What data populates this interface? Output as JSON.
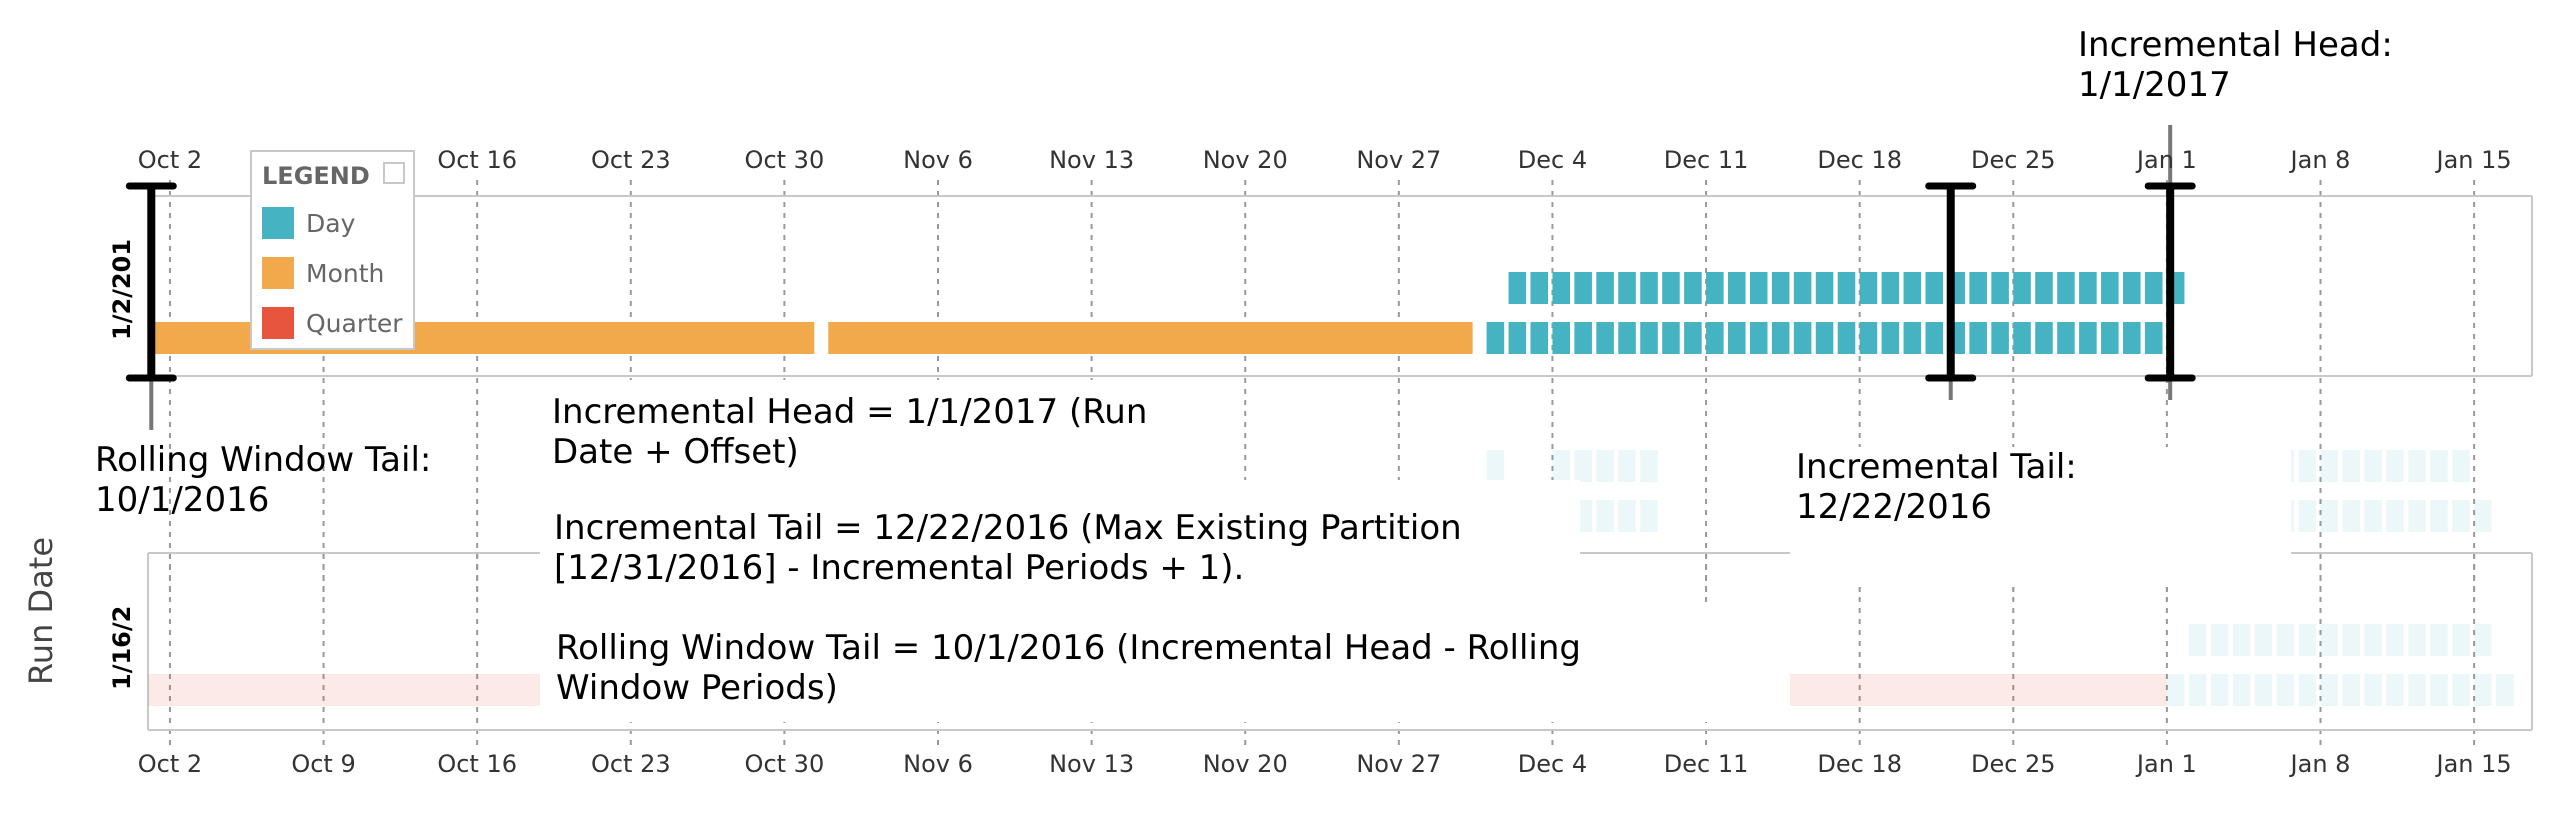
{
  "chart_data": {
    "type": "gantt",
    "y_axis_title": "Run Date",
    "x_tick_labels": [
      "Oct 2",
      "Oct 9",
      "Oct 16",
      "Oct 23",
      "Oct 30",
      "Nov 6",
      "Nov 13",
      "Nov 20",
      "Nov 27",
      "Dec 4",
      "Dec 11",
      "Dec 18",
      "Dec 25",
      "Jan 1",
      "Jan 8",
      "Jan 15"
    ],
    "x_range": [
      "2016-10-01",
      "2017-01-17"
    ],
    "rows": [
      {
        "label": "1/2/201",
        "partitions": {
          "month": [
            {
              "start": "2016-10-01",
              "end": "2016-10-31"
            },
            {
              "start": "2016-11-01",
              "end": "2016-11-30"
            }
          ],
          "day_lower": {
            "start": "2016-12-01",
            "end": "2016-12-31"
          },
          "day_upper": {
            "start": "2016-12-02",
            "end": "2017-01-01"
          }
        },
        "markers": [
          "2016-10-01",
          "2016-12-22",
          "2017-01-01"
        ]
      },
      {
        "label": "1/16/2",
        "partitions": {
          "quarter": [
            {
              "start": "2016-10-01",
              "end": "2016-12-31"
            }
          ],
          "day_lower": {
            "start": "2017-01-01",
            "end": "2017-01-16"
          },
          "day_upper": {
            "start": "2017-01-02",
            "end": "2017-01-15"
          }
        }
      }
    ],
    "ghost_partitions": {
      "upper": [
        "2016-12-01",
        "2016-12-04",
        "2016-12-05",
        "2016-12-06",
        "2016-12-07",
        "2016-12-08",
        "2017-01-04",
        "2017-01-05",
        "2017-01-06",
        "2017-01-07",
        "2017-01-08",
        "2017-01-09",
        "2017-01-10",
        "2017-01-11",
        "2017-01-12",
        "2017-01-13",
        "2017-01-14"
      ],
      "lower": [
        "2016-12-04",
        "2016-12-05",
        "2016-12-06",
        "2016-12-07",
        "2016-12-08",
        "2017-01-05",
        "2017-01-06",
        "2017-01-07",
        "2017-01-08",
        "2017-01-09",
        "2017-01-10",
        "2017-01-11",
        "2017-01-12",
        "2017-01-13",
        "2017-01-14",
        "2017-01-15"
      ]
    },
    "legend": {
      "title": "LEGEND",
      "placement": "top-left",
      "items": [
        {
          "label": "Day",
          "color": "#45b3c2"
        },
        {
          "label": "Month",
          "color": "#f2a94c"
        },
        {
          "label": "Quarter",
          "color": "#e8553f"
        }
      ]
    },
    "colors": {
      "day": "#45b3c2",
      "month": "#f2a94c",
      "quarter": "#e8553f",
      "marker": "#000000"
    },
    "grid": "dashed vertical"
  },
  "annotations": {
    "incremental_head_title": "Incremental Head:",
    "incremental_head_date": "1/1/2017",
    "rolling_tail_title": "Rolling Window Tail:",
    "rolling_tail_date": "10/1/2016",
    "incremental_tail_title": "Incremental Tail:",
    "incremental_tail_date": "12/22/2016",
    "head_formula_1": "Incremental Head = 1/1/2017 (Run",
    "head_formula_2": "Date + Offset)",
    "tail_formula_1": "Incremental Tail = 12/22/2016 (Max Existing Partition",
    "tail_formula_2": "[12/31/2016] - Incremental Periods + 1).",
    "rolling_formula_1": "Rolling Window Tail = 10/1/2016 (Incremental Head - Rolling",
    "rolling_formula_2": "Window Periods)"
  }
}
